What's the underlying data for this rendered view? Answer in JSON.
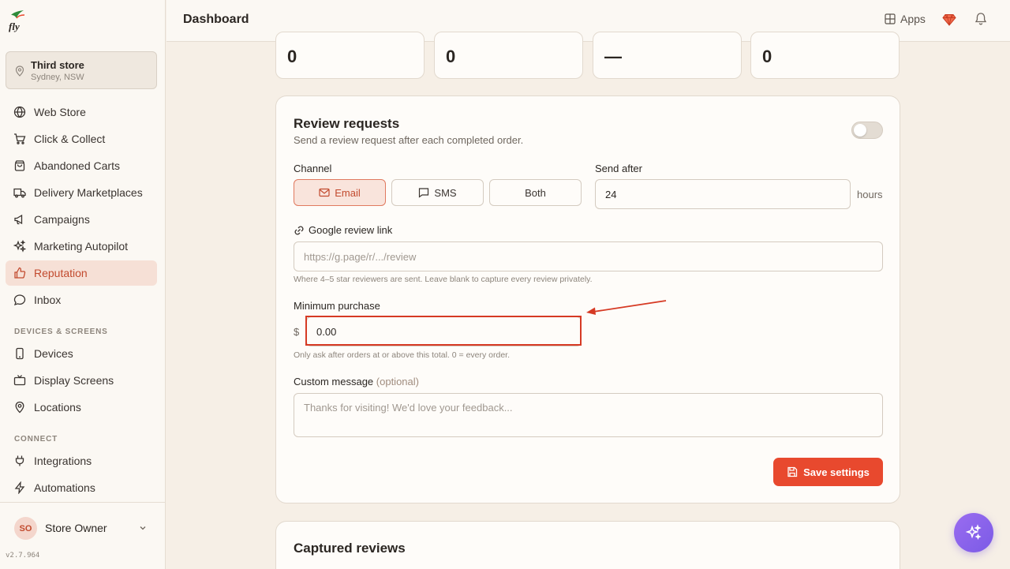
{
  "topbar": {
    "title": "Dashboard",
    "apps_label": "Apps"
  },
  "store": {
    "name": "Third store",
    "location": "Sydney, NSW"
  },
  "nav": {
    "items": [
      {
        "label": "Web Store",
        "icon": "globe-icon"
      },
      {
        "label": "Click & Collect",
        "icon": "cart-icon"
      },
      {
        "label": "Abandoned Carts",
        "icon": "bag-icon"
      },
      {
        "label": "Delivery Marketplaces",
        "icon": "truck-icon"
      },
      {
        "label": "Campaigns",
        "icon": "megaphone-icon"
      },
      {
        "label": "Marketing Autopilot",
        "icon": "sparkle-icon"
      },
      {
        "label": "Reputation",
        "icon": "thumbs-up-icon",
        "active": true
      },
      {
        "label": "Inbox",
        "icon": "chat-icon"
      }
    ],
    "section_devices": "DEVICES & SCREENS",
    "devices_items": [
      {
        "label": "Devices",
        "icon": "phone-icon"
      },
      {
        "label": "Display Screens",
        "icon": "tv-icon"
      },
      {
        "label": "Locations",
        "icon": "pin-icon"
      }
    ],
    "section_connect": "CONNECT",
    "connect_items": [
      {
        "label": "Integrations",
        "icon": "plug-icon"
      },
      {
        "label": "Automations",
        "icon": "bolt-icon"
      }
    ]
  },
  "user": {
    "initials": "SO",
    "name": "Store Owner"
  },
  "version": "v2.7.964",
  "stats": {
    "values": [
      "0",
      "0",
      "—",
      "0"
    ]
  },
  "review": {
    "title": "Review requests",
    "subtitle": "Send a review request after each completed order.",
    "enabled": false,
    "channel_label": "Channel",
    "channels": [
      "Email",
      "SMS",
      "Both"
    ],
    "selected_channel": "Email",
    "send_after_label": "Send after",
    "send_after_value": "24",
    "send_after_unit": "hours",
    "google_label": "Google review link",
    "google_placeholder": "https://g.page/r/.../review",
    "google_hint": "Where 4–5 star reviewers are sent. Leave blank to capture every review privately.",
    "min_purchase_label": "Minimum purchase",
    "currency": "$",
    "min_purchase_value": "0.00",
    "min_purchase_hint": "Only ask after orders at or above this total. 0 = every order.",
    "custom_message_label": "Custom message",
    "custom_message_optional": "(optional)",
    "custom_message_placeholder": "Thanks for visiting! We'd love your feedback...",
    "save_label": "Save settings"
  },
  "captured": {
    "title": "Captured reviews"
  },
  "colors": {
    "accent": "#e8492e",
    "active_bg": "#f6e0d6",
    "fab": "#8b63ec"
  }
}
